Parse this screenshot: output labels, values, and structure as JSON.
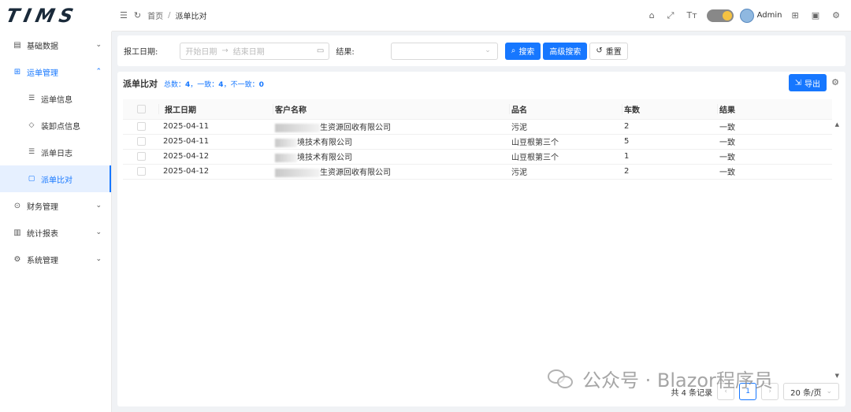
{
  "logo": "TIMS",
  "header": {
    "breadcrumb_home": "首页",
    "breadcrumb_sep": "/",
    "breadcrumb_current": "派单比对",
    "username": "Admin",
    "font_size_label": "Tт"
  },
  "sidebar": {
    "items": [
      {
        "label": "基础数据",
        "icon": "database-icon",
        "state": "collapsed"
      },
      {
        "label": "运单管理",
        "icon": "grid-icon",
        "state": "expanded",
        "children": [
          {
            "label": "运单信息",
            "icon": "list-icon"
          },
          {
            "label": "装卸点信息",
            "icon": "tag-icon"
          },
          {
            "label": "派单日志",
            "icon": "list-icon"
          },
          {
            "label": "派单比对",
            "icon": "compare-icon",
            "active": true
          }
        ]
      },
      {
        "label": "财务管理",
        "icon": "finance-icon",
        "state": "collapsed"
      },
      {
        "label": "统计报表",
        "icon": "chart-icon",
        "state": "collapsed"
      },
      {
        "label": "系统管理",
        "icon": "settings-icon",
        "state": "collapsed"
      }
    ]
  },
  "search": {
    "date_label": "报工日期:",
    "start_placeholder": "开始日期",
    "end_placeholder": "结束日期",
    "result_label": "结果:",
    "result_value": "",
    "search_button": "搜索",
    "advanced_button": "高级搜索",
    "reset_button": "重置"
  },
  "table": {
    "title": "派单比对",
    "stats_prefix": "总数：",
    "total": "4",
    "consistent_label": "，一致：",
    "consistent": "4",
    "inconsistent_label": "，不一致：",
    "inconsistent": "0",
    "export_button": "导出",
    "columns": [
      "报工日期",
      "客户名称",
      "品名",
      "车数",
      "结果"
    ],
    "rows": [
      {
        "date": "2025-04-11",
        "customer_visible": "生资源回收有限公司",
        "product": "污泥",
        "trucks": "2",
        "result": "一致"
      },
      {
        "date": "2025-04-11",
        "customer_visible": "境技术有限公司",
        "product": "山豆根第三个",
        "trucks": "5",
        "result": "一致"
      },
      {
        "date": "2025-04-12",
        "customer_visible": "境技术有限公司",
        "product": "山豆根第三个",
        "trucks": "1",
        "result": "一致"
      },
      {
        "date": "2025-04-12",
        "customer_visible": "生资源回收有限公司",
        "product": "污泥",
        "trucks": "2",
        "result": "一致"
      }
    ]
  },
  "pagination": {
    "total_text": "共 4 条记录",
    "current_page": "1",
    "page_size": "20 条/页"
  },
  "watermark": "公众号 · Blazor程序员",
  "colors": {
    "primary": "#1677ff",
    "sidebar_active_bg": "#e6f0ff"
  }
}
